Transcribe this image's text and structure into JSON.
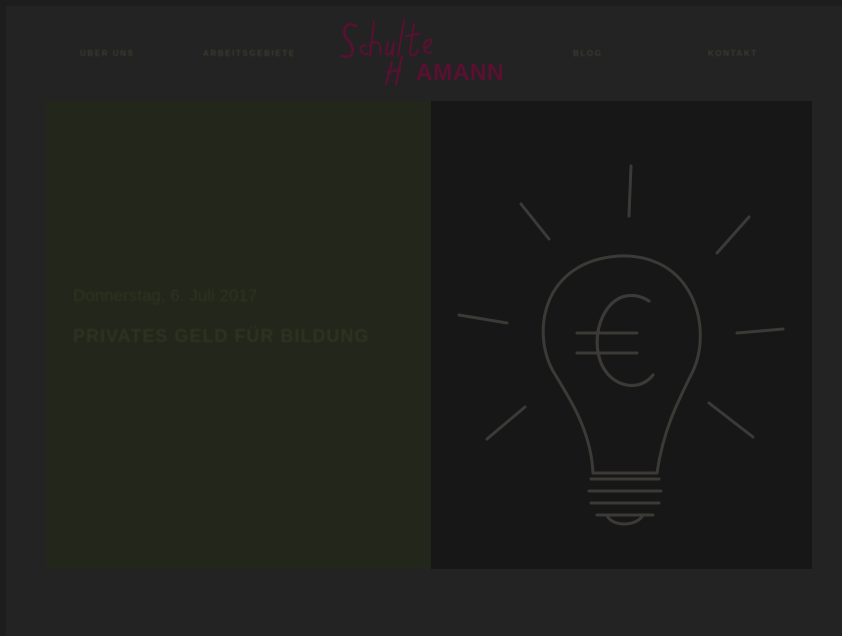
{
  "nav": {
    "items": [
      {
        "label": "Über uns"
      },
      {
        "label": "Arbeitsgebiete"
      },
      {
        "label": "Blog"
      },
      {
        "label": "Kontakt"
      }
    ]
  },
  "logo": {
    "line1": "Schulte",
    "line2": "Hamann"
  },
  "hero": {
    "date": "Donnerstag, 6. Juli 2017",
    "title": "Privates Geld für Bildung",
    "image_icon": "lightbulb-euro-icon"
  },
  "colors": {
    "page_background": "#1d1d1d",
    "hero_panel": "#23261a",
    "logo_accent": "#5a1030"
  }
}
